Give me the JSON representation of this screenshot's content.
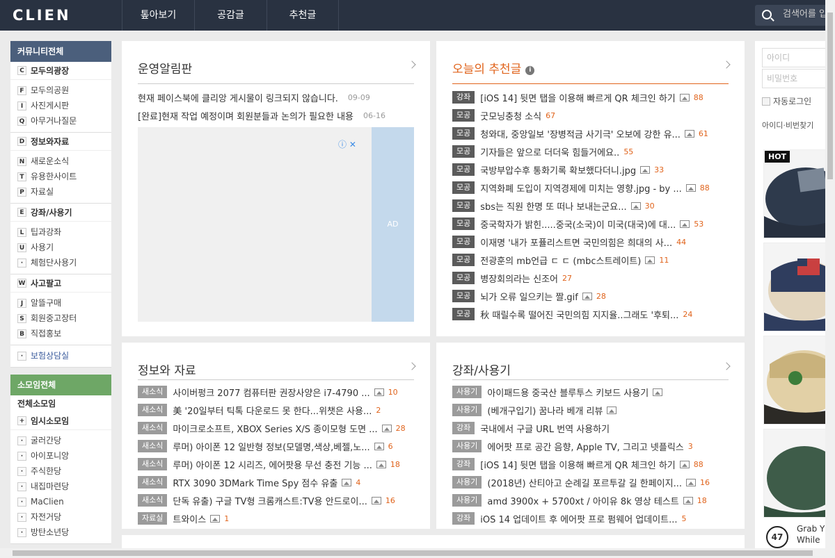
{
  "header": {
    "logo": "CLIEN",
    "nav": [
      "톺아보기",
      "공감글",
      "추천글"
    ],
    "search_placeholder": "검색어를 입력해주세요"
  },
  "sidebar": {
    "community_title": "커뮤니티전체",
    "groups": [
      {
        "letter": "C",
        "label": "모두의광장",
        "items": [
          {
            "letter": "F",
            "label": "모두의공원"
          },
          {
            "letter": "I",
            "label": "사진게시판"
          },
          {
            "letter": "Q",
            "label": "아무거나질문"
          }
        ]
      },
      {
        "letter": "D",
        "label": "정보와자료",
        "items": [
          {
            "letter": "N",
            "label": "새로운소식"
          },
          {
            "letter": "T",
            "label": "유용한사이트"
          },
          {
            "letter": "P",
            "label": "자료실"
          }
        ]
      },
      {
        "letter": "E",
        "label": "강좌/사용기",
        "items": [
          {
            "letter": "L",
            "label": "팁과강좌"
          },
          {
            "letter": "U",
            "label": "사용기"
          },
          {
            "letter": "·",
            "label": "체험단사용기"
          }
        ]
      },
      {
        "letter": "W",
        "label": "사고팔고",
        "items": [
          {
            "letter": "J",
            "label": "알뜰구매"
          },
          {
            "letter": "S",
            "label": "회원중고장터"
          },
          {
            "letter": "B",
            "label": "직접홍보"
          }
        ]
      }
    ],
    "insurance": "보험상담실",
    "somoim_title": "소모임전체",
    "somoim_all": "전체소모임",
    "temp_somoim": "임시소모임",
    "somoim_items": [
      "굴러간당",
      "아이포니앙",
      "주식한당",
      "내집마련당",
      "MaClien",
      "자전거당",
      "방탄소년당"
    ]
  },
  "notice": {
    "title": "운영알림판",
    "items": [
      {
        "text": "현재 페이스북에 클리앙 게시물이 링크되지 않습니다.",
        "date": "09-09"
      },
      {
        "text": "[완료]현재 작업 예정이며 회원분들과 논의가 필요한 내용",
        "date": "06-16"
      }
    ],
    "ad_label": "AD"
  },
  "recommend": {
    "title": "오늘의 추천글",
    "items": [
      {
        "badge": "강좌",
        "text": "[iOS 14] 뒷면 탭을 이용해 빠르게 QR 체크인 하기",
        "img": true,
        "count": "88"
      },
      {
        "badge": "모공",
        "text": "굿모닝충청 소식",
        "img": false,
        "count": "67"
      },
      {
        "badge": "모공",
        "text": "청와대, 중앙일보 '장병적금 사기극' 오보에 강한 유...",
        "img": true,
        "count": "61"
      },
      {
        "badge": "모공",
        "text": "기자들은 앞으로 더더욱 힘들거에요..",
        "img": false,
        "count": "55"
      },
      {
        "badge": "모공",
        "text": "국방부압수후 통화기록 확보했다더니.jpg",
        "img": true,
        "count": "33"
      },
      {
        "badge": "모공",
        "text": "지역화폐 도입이 지역경제에 미치는 영향.jpg - by ...",
        "img": true,
        "count": "88"
      },
      {
        "badge": "모공",
        "text": "sbs는 직원 한명 또 떠나 보내는군요...",
        "img": true,
        "count": "30"
      },
      {
        "badge": "모공",
        "text": "중국학자가 밝힌.....중국(소국)이 미국(대국)에 대...",
        "img": true,
        "count": "53"
      },
      {
        "badge": "모공",
        "text": "이재명 '내가 포퓰리스트면 국민의힘은 희대의 사...",
        "img": false,
        "count": "44"
      },
      {
        "badge": "모공",
        "text": "전광훈의 mb언급 ㄷ ㄷ (mbc스트레이트)",
        "img": true,
        "count": "11"
      },
      {
        "badge": "모공",
        "text": "병장회의라는 신조어",
        "img": false,
        "count": "27"
      },
      {
        "badge": "모공",
        "text": "뇌가 오류 일으키는 짤.gif",
        "img": true,
        "count": "28"
      },
      {
        "badge": "모공",
        "text": "秋 때릴수록 떨어진 국민의힘 지지율..그래도 '후퇴...",
        "img": false,
        "count": "24"
      }
    ]
  },
  "info": {
    "title": "정보와 자료",
    "items": [
      {
        "badge": "새소식",
        "text": "사이버펑크 2077 컴퓨터판 권장사양은 i7-4790 ...",
        "img": true,
        "count": "10"
      },
      {
        "badge": "새소식",
        "text": "美 '20일부터 틱톡 다운로드 못 한다...위챗은 사용...",
        "img": false,
        "count": "2"
      },
      {
        "badge": "새소식",
        "text": "마이크로소프트, XBOX Series X/S 종이모형 도면 ...",
        "img": true,
        "count": "28"
      },
      {
        "badge": "새소식",
        "text": "루머) 아이폰 12 일반형 정보(모델명,색상,베젤,노...",
        "img": true,
        "count": "6"
      },
      {
        "badge": "새소식",
        "text": "루머) 아이폰 12 시리즈, 에어팟용 무선 충전 기능 ...",
        "img": true,
        "count": "18"
      },
      {
        "badge": "새소식",
        "text": "RTX 3090 3DMark Time Spy 점수 유출",
        "img": true,
        "count": "4"
      },
      {
        "badge": "새소식",
        "text": "단독 유출) 구글 TV형 크롬캐스트:TV용 안드로이...",
        "img": true,
        "count": "16"
      },
      {
        "badge": "자료실",
        "text": "트와이스",
        "img": true,
        "count": "1"
      }
    ]
  },
  "lecture": {
    "title": "강좌/사용기",
    "items": [
      {
        "badge": "사용기",
        "text": "아이패드용 중국산 블루투스 키보드 사용기",
        "img": true,
        "count": ""
      },
      {
        "badge": "사용기",
        "text": "(베개구입기) 꿈나라 베개 리뷰",
        "img": true,
        "count": ""
      },
      {
        "badge": "강좌",
        "text": "국내에서 구글 URL 번역 사용하기",
        "img": false,
        "count": ""
      },
      {
        "badge": "사용기",
        "text": "에어팟 프로 공간 음향, Apple TV, 그리고 넷플릭스",
        "img": false,
        "count": "3"
      },
      {
        "badge": "강좌",
        "text": "[iOS 14] 뒷면 탭을 이용해 빠르게 QR 체크인 하기",
        "img": true,
        "count": "88"
      },
      {
        "badge": "사용기",
        "text": "(2018년) 산티아고 순례길 포르투갈 길 한페이지...",
        "img": true,
        "count": "16"
      },
      {
        "badge": "사용기",
        "text": "amd 3900x + 5700xt / 아이유 8k 영상 테스트",
        "img": true,
        "count": "18"
      },
      {
        "badge": "강좌",
        "text": "iOS 14 업데이트 후 에어팟 프로 펌웨어 업데이트...",
        "img": false,
        "count": "5"
      }
    ]
  },
  "login": {
    "id_placeholder": "아이디",
    "pw_placeholder": "비밀번호",
    "auto_login": "자동로그인",
    "find": "아이디·비번찾기"
  },
  "ad_right": {
    "hot": "HOT",
    "brand": "47",
    "line1": "Grab Y",
    "line2": "While"
  },
  "colors": {
    "topbar": "#293241",
    "accent": "#e0631b",
    "sidebar_head": "#4b5f7c",
    "somoim_head": "#6ea766"
  }
}
